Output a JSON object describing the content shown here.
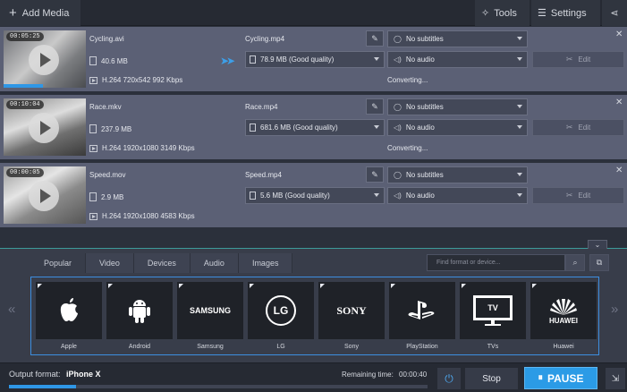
{
  "topbar": {
    "add_media": "Add Media",
    "tools": "Tools",
    "settings": "Settings"
  },
  "files": [
    {
      "thumb_time": "00:05:25",
      "progress": 0.48,
      "source_name": "Cycling.avi",
      "source_size": "40.6 MB",
      "source_codec": "H.264 720x542 992 Kbps",
      "output_name": "Cycling.mp4",
      "output_quality": "78.9 MB (Good quality)",
      "status": "Converting...",
      "subtitles": "No subtitles",
      "audio": "No audio",
      "edit": "Edit"
    },
    {
      "thumb_time": "00:10:04",
      "progress": 0,
      "source_name": "Race.mkv",
      "source_size": "237.9 MB",
      "source_codec": "H.264 1920x1080 3149 Kbps",
      "output_name": "Race.mp4",
      "output_quality": "681.6 MB (Good quality)",
      "status": "Converting...",
      "subtitles": "No subtitles",
      "audio": "No audio",
      "edit": "Edit"
    },
    {
      "thumb_time": "00:00:05",
      "progress": 0,
      "source_name": "Speed.mov",
      "source_size": "2.9 MB",
      "source_codec": "H.264 1920x1080 4583 Kbps",
      "output_name": "Speed.mp4",
      "output_quality": "5.6 MB (Good quality)",
      "status": "",
      "subtitles": "No subtitles",
      "audio": "No audio",
      "edit": "Edit"
    }
  ],
  "format_panel": {
    "tabs": [
      "Popular",
      "Video",
      "Devices",
      "Audio",
      "Images"
    ],
    "search_placeholder": "Find format or device...",
    "devices": [
      {
        "label": "Apple",
        "logo": "apple-logo-icon"
      },
      {
        "label": "Android",
        "logo": "android-logo-icon"
      },
      {
        "label": "Samsung",
        "logo_text": "SAMSUNG"
      },
      {
        "label": "LG",
        "logo_text": "LG"
      },
      {
        "label": "Sony",
        "logo_text": "SONY"
      },
      {
        "label": "PlayStation",
        "logo": "playstation-logo-icon"
      },
      {
        "label": "TVs",
        "logo_text": "TV"
      },
      {
        "label": "Huawei",
        "logo_text": "HUAWEI"
      }
    ]
  },
  "bottom": {
    "output_format_label": "Output format:",
    "output_format_value": "iPhone X",
    "remaining_label": "Remaining time:",
    "remaining_value": "00:00:40",
    "overall_progress": 0.16,
    "stop": "Stop",
    "pause": "PAUSE"
  },
  "colors": {
    "accent": "#2b9be6",
    "row_bg": "#5b6075",
    "panel_bg": "#383d4a"
  }
}
